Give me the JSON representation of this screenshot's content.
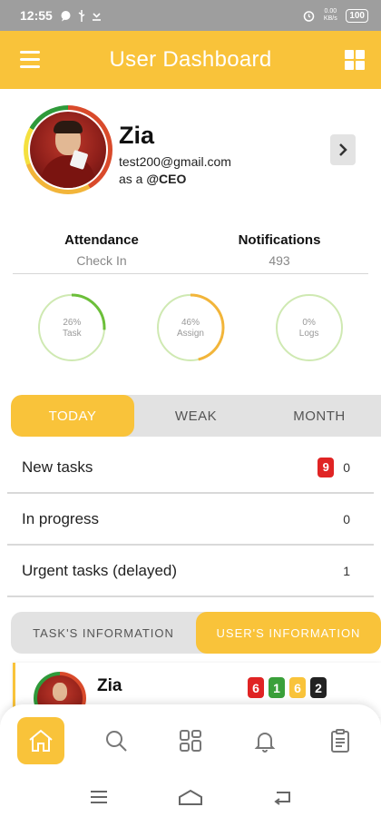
{
  "status_bar": {
    "time": "12:55",
    "right_text": "0.00 KB/s",
    "battery": "100"
  },
  "app_bar": {
    "title": "User Dashboard"
  },
  "profile": {
    "name": "Zia",
    "email": "test200@gmail.com",
    "role_prefix": "as a",
    "role": "@CEO",
    "ring_colors": [
      "#d94a2b",
      "#f2b53a",
      "#f4e03f",
      "#2f9a3a"
    ]
  },
  "stats": {
    "attendance_label": "Attendance",
    "attendance_value": "Check In",
    "notifications_label": "Notifications",
    "notifications_value": "493"
  },
  "gauges": [
    {
      "percent_text": "26%",
      "label": "Task",
      "value": 0.26
    },
    {
      "percent_text": "46%",
      "label": "Assign",
      "value": 0.46
    },
    {
      "percent_text": "0%",
      "label": "Logs",
      "value": 0.0
    }
  ],
  "period_tabs": {
    "today": "TODAY",
    "weak": "WEAK",
    "month": "MONTH",
    "active": "today"
  },
  "tasks": {
    "new_label": "New tasks",
    "new_badge": "9",
    "new_count": "0",
    "progress_label": "In progress",
    "progress_count": "0",
    "urgent_label": "Urgent tasks (delayed)",
    "urgent_count": "1"
  },
  "info_tabs": {
    "task_info": "TASK'S INFORMATION",
    "user_info": "USER'S INFORMATION",
    "active": "user_info"
  },
  "user_card": {
    "name": "Zia",
    "badges": [
      {
        "value": "6",
        "color": "#e02424"
      },
      {
        "value": "1",
        "color": "#3aa03a"
      },
      {
        "value": "6",
        "color": "#f9c33a"
      },
      {
        "value": "2",
        "color": "#222222"
      }
    ]
  },
  "bottom_nav": {
    "items": [
      "home-icon",
      "search-icon",
      "dashboard-icon",
      "bell-icon",
      "clipboard-icon"
    ],
    "active": "home-icon"
  },
  "colors": {
    "accent": "#f9c33a",
    "gauge_track": "#b7e08a",
    "gauge_fill": "#6cbf3a",
    "gauge_fill_assign": "#f2b53a"
  }
}
